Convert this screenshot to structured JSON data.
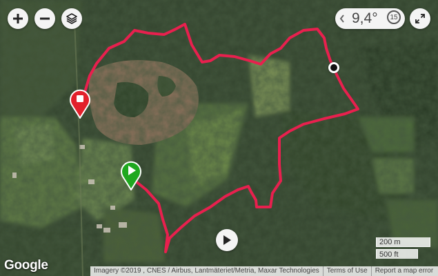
{
  "controls": {
    "zoom_in_icon": "plus-icon",
    "zoom_out_icon": "minus-icon",
    "layers_icon": "layers-icon",
    "fullscreen_icon": "expand-arrows-icon",
    "play_icon": "play-icon"
  },
  "stat_widget": {
    "value": "9,4°",
    "badge": "15",
    "prev_icon": "chevron-left-icon"
  },
  "markers": {
    "start_icon": "play-icon",
    "end_icon": "stop-icon",
    "start_color": "#1fa81f",
    "end_color": "#e2202b",
    "position_color": "#111111"
  },
  "track": {
    "color": "#e8204e"
  },
  "scale": {
    "metric": "200 m",
    "imperial": "500 ft"
  },
  "branding": {
    "logo": "Google"
  },
  "attribution": {
    "imagery": "Imagery ©2019 , CNES / Airbus, Lantmäteriet/Metria, Maxar Technologies",
    "terms": "Terms of Use",
    "report": "Report a map error"
  }
}
